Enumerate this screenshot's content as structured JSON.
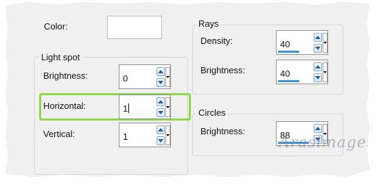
{
  "color": {
    "label": "Color:",
    "value": "#ffffff"
  },
  "light_spot": {
    "title": "Light spot",
    "brightness": {
      "label": "Brightness:",
      "value": "0"
    },
    "horizontal": {
      "label": "Horizontal:",
      "value": "1"
    },
    "vertical": {
      "label": "Vertical:",
      "value": "1"
    }
  },
  "rays": {
    "title": "Rays",
    "density": {
      "label": "Density:",
      "value": "40"
    },
    "brightness": {
      "label": "Brightness:",
      "value": "40"
    }
  },
  "circles": {
    "title": "Circles",
    "brightness": {
      "label": "Brightness:",
      "value": "88"
    }
  },
  "watermark_text": "Arasimages",
  "colors": {
    "highlight": "#8ed64a",
    "accent_bar": "#3b8fd6"
  }
}
